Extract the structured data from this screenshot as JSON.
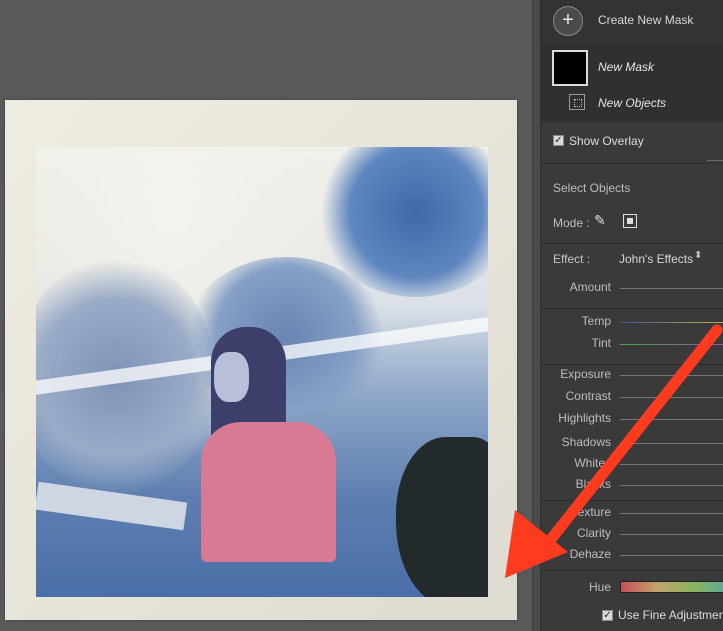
{
  "masks_panel": {
    "create_button_icon": "plus-icon",
    "create_label": "Create New Mask",
    "mask_name": "New Mask",
    "component_name": "New Objects",
    "component_icon": "select-objects-icon"
  },
  "overlay": {
    "label": "Show Overlay",
    "checked": true
  },
  "select_objects": {
    "title": "Select Objects",
    "mode_label": "Mode :",
    "mode_icons": [
      "brush-select-icon",
      "rectangle-select-icon"
    ]
  },
  "effect": {
    "label": "Effect :",
    "value": "John's Effects",
    "chevron": "⌃⌄"
  },
  "sliders": {
    "amount": "Amount",
    "temp": "Temp",
    "tint": "Tint",
    "exposure": "Exposure",
    "contrast": "Contrast",
    "highlights": "Highlights",
    "shadows": "Shadows",
    "whites": "Whites",
    "blacks": "Blacks",
    "texture": "Texture",
    "clarity": "Clarity",
    "dehaze": "Dehaze",
    "hue": "Hue"
  },
  "fine_adjust": {
    "label": "Use Fine Adjustment",
    "checked": true
  },
  "annotation": {
    "arrow_color": "#ff3b1f"
  },
  "colors": {
    "panel_bg": "#3a3a3a",
    "canvas_bg": "#595959"
  }
}
